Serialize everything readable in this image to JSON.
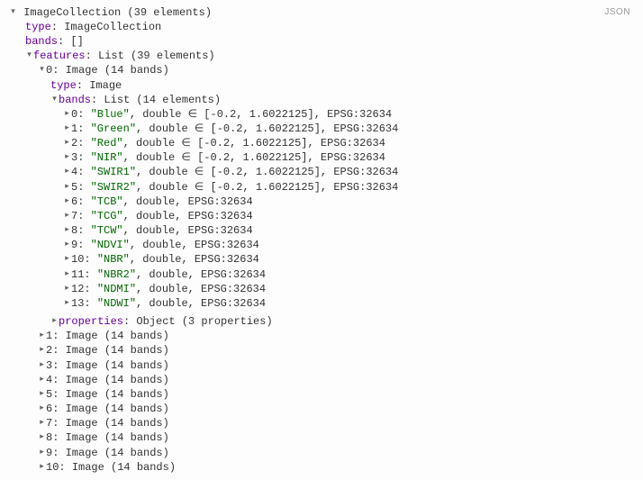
{
  "jsonButton": "JSON",
  "root": {
    "label": "ImageCollection (39 elements)",
    "typeKey": "type",
    "typeVal": "ImageCollection",
    "bandsKey": "bands",
    "bandsVal": "[]",
    "featuresKey": "features",
    "featuresVal": "List (39 elements)"
  },
  "feat0": {
    "idx": "0",
    "label": "Image (14 bands)",
    "typeKey": "type",
    "typeVal": "Image",
    "bandsKey": "bands",
    "bandsVal": "List (14 elements)"
  },
  "bands": [
    {
      "idx": "0",
      "name": "Blue",
      "rest": ", double ∈ [-0.2, 1.6022125], EPSG:32634"
    },
    {
      "idx": "1",
      "name": "Green",
      "rest": ", double ∈ [-0.2, 1.6022125], EPSG:32634"
    },
    {
      "idx": "2",
      "name": "Red",
      "rest": ", double ∈ [-0.2, 1.6022125], EPSG:32634"
    },
    {
      "idx": "3",
      "name": "NIR",
      "rest": ", double ∈ [-0.2, 1.6022125], EPSG:32634"
    },
    {
      "idx": "4",
      "name": "SWIR1",
      "rest": ", double ∈ [-0.2, 1.6022125], EPSG:32634"
    },
    {
      "idx": "5",
      "name": "SWIR2",
      "rest": ", double ∈ [-0.2, 1.6022125], EPSG:32634"
    },
    {
      "idx": "6",
      "name": "TCB",
      "rest": ", double, EPSG:32634"
    },
    {
      "idx": "7",
      "name": "TCG",
      "rest": ", double, EPSG:32634"
    },
    {
      "idx": "8",
      "name": "TCW",
      "rest": ", double, EPSG:32634"
    },
    {
      "idx": "9",
      "name": "NDVI",
      "rest": ", double, EPSG:32634"
    },
    {
      "idx": "10",
      "name": "NBR",
      "rest": ", double, EPSG:32634"
    },
    {
      "idx": "11",
      "name": "NBR2",
      "rest": ", double, EPSG:32634"
    },
    {
      "idx": "12",
      "name": "NDMI",
      "rest": ", double, EPSG:32634"
    },
    {
      "idx": "13",
      "name": "NDWI",
      "rest": ", double, EPSG:32634"
    }
  ],
  "feat0props": {
    "key": "properties",
    "val": "Object (3 properties)"
  },
  "features_rest": [
    {
      "idx": "1",
      "label": "Image (14 bands)"
    },
    {
      "idx": "2",
      "label": "Image (14 bands)"
    },
    {
      "idx": "3",
      "label": "Image (14 bands)"
    },
    {
      "idx": "4",
      "label": "Image (14 bands)"
    },
    {
      "idx": "5",
      "label": "Image (14 bands)"
    },
    {
      "idx": "6",
      "label": "Image (14 bands)"
    },
    {
      "idx": "7",
      "label": "Image (14 bands)"
    },
    {
      "idx": "8",
      "label": "Image (14 bands)"
    },
    {
      "idx": "9",
      "label": "Image (14 bands)"
    },
    {
      "idx": "10",
      "label": "Image (14 bands)"
    }
  ]
}
